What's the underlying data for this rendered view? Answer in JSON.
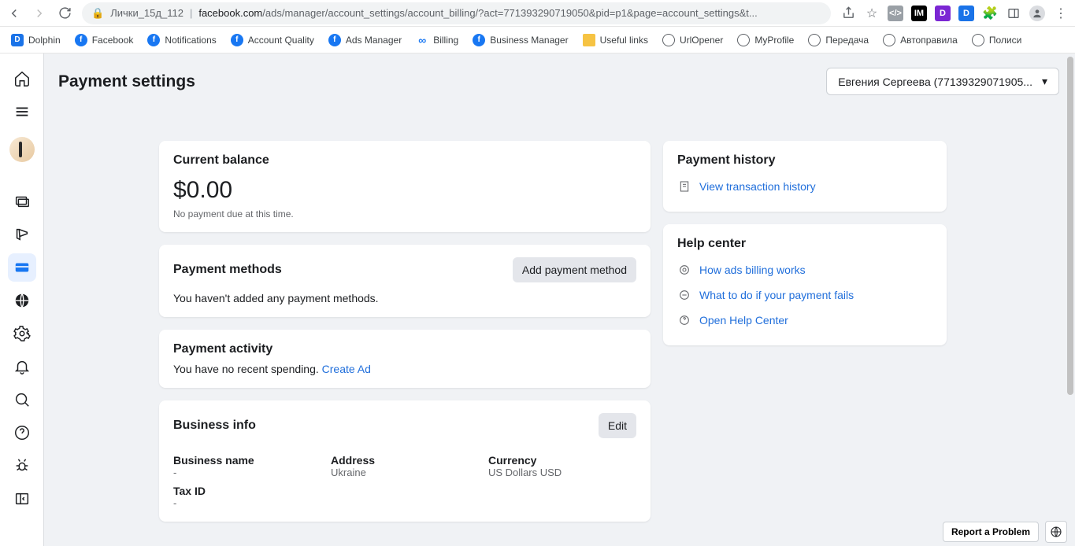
{
  "chrome": {
    "tab_name": "Лички_15д_112",
    "domain": "facebook.com",
    "path": "/ads/manager/account_settings/account_billing/?act=771393290719050&pid=p1&page=account_settings&t..."
  },
  "bookmarks": [
    {
      "icon": "d",
      "label": "Dolphin"
    },
    {
      "icon": "fb",
      "label": "Facebook"
    },
    {
      "icon": "fb",
      "label": "Notifications"
    },
    {
      "icon": "fb",
      "label": "Account Quality"
    },
    {
      "icon": "fb",
      "label": "Ads Manager"
    },
    {
      "icon": "meta",
      "label": "Billing"
    },
    {
      "icon": "fb",
      "label": "Business Manager"
    },
    {
      "icon": "folder",
      "label": "Useful links"
    },
    {
      "icon": "globe",
      "label": "UrlOpener"
    },
    {
      "icon": "globe",
      "label": "MyProfile"
    },
    {
      "icon": "globe",
      "label": "Передача"
    },
    {
      "icon": "globe",
      "label": "Автоправила"
    },
    {
      "icon": "globe",
      "label": "Полиси"
    }
  ],
  "page": {
    "title": "Payment settings",
    "account_selector": "Евгения Сергеева (77139329071905..."
  },
  "balance": {
    "title": "Current balance",
    "amount": "$0.00",
    "note": "No payment due at this time."
  },
  "methods": {
    "title": "Payment methods",
    "add_btn": "Add payment method",
    "empty": "You haven't added any payment methods."
  },
  "activity": {
    "title": "Payment activity",
    "text": "You have no recent spending. ",
    "link": "Create Ad"
  },
  "business": {
    "title": "Business info",
    "edit": "Edit",
    "name_label": "Business name",
    "name_val": "-",
    "addr_label": "Address",
    "addr_val": "Ukraine",
    "curr_label": "Currency",
    "curr_val": "US Dollars USD",
    "tax_label": "Tax ID",
    "tax_val": "-"
  },
  "history": {
    "title": "Payment history",
    "link": "View transaction history"
  },
  "help": {
    "title": "Help center",
    "links": [
      "How ads billing works",
      "What to do if your payment fails",
      "Open Help Center"
    ]
  },
  "footer": {
    "report": "Report a Problem"
  }
}
